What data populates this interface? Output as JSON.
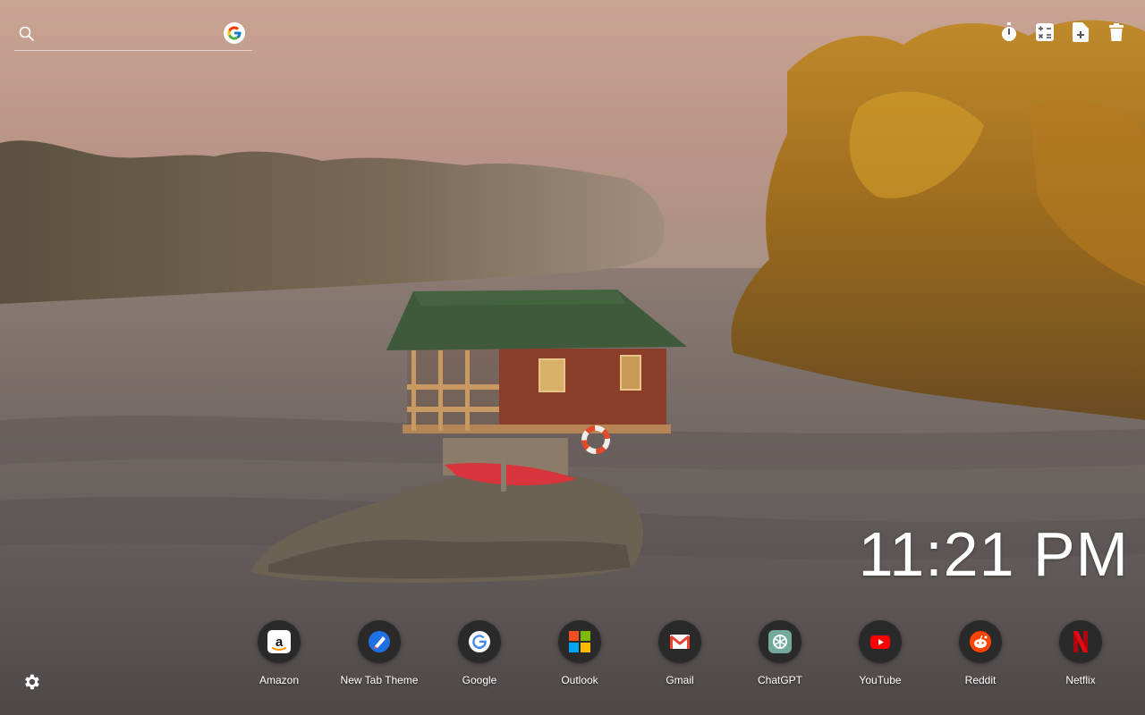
{
  "search": {
    "value": "",
    "placeholder": ""
  },
  "toolbar": {
    "icons": [
      "stopwatch-icon",
      "calculator-icon",
      "new-file-icon",
      "trash-icon"
    ]
  },
  "clock": {
    "time": "11:21 PM"
  },
  "shortcuts": [
    {
      "label": "Amazon",
      "icon": "amazon-icon"
    },
    {
      "label": "New Tab Theme",
      "icon": "new-tab-theme-icon"
    },
    {
      "label": "Google",
      "icon": "google-icon"
    },
    {
      "label": "Outlook",
      "icon": "outlook-icon"
    },
    {
      "label": "Gmail",
      "icon": "gmail-icon"
    },
    {
      "label": "ChatGPT",
      "icon": "chatgpt-icon"
    },
    {
      "label": "YouTube",
      "icon": "youtube-icon"
    },
    {
      "label": "Reddit",
      "icon": "reddit-icon"
    },
    {
      "label": "Netflix",
      "icon": "netflix-icon"
    }
  ],
  "settings": {
    "icon": "gear-icon"
  },
  "colors": {
    "sky": "#c9a493",
    "water": "#6d6564",
    "foliage": "#c98a1e",
    "roof": "#3e5a3a"
  }
}
